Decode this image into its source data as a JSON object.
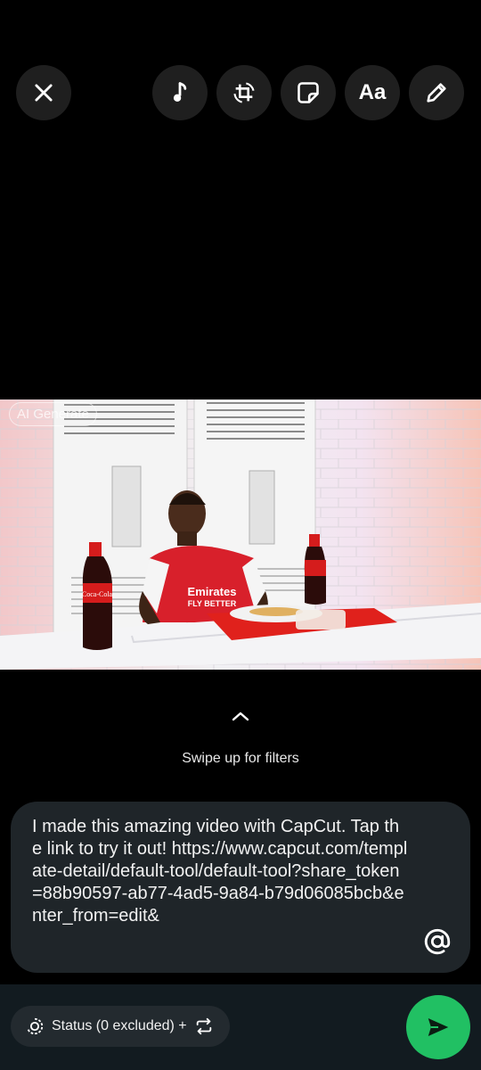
{
  "toolbar": {
    "close": "close-icon",
    "music": "music-note-icon",
    "crop": "crop-rotate-icon",
    "sticker": "sticker-icon",
    "text_label": "Aa",
    "draw": "pencil-icon"
  },
  "media": {
    "ai_badge": "AI Generate",
    "jersey_text": "Emirates FLY BETTER"
  },
  "filters": {
    "hint": "Swipe up for filters"
  },
  "caption": {
    "text": "I made this amazing video with CapCut. Tap the link to try it out! https://www.capcut.com/template-detail/default-tool/default-tool?share_token=88b90597-ab77-4ad5-9a84-b79d06085bcb&enter_from=edit&",
    "mention_icon": "at-sign-icon"
  },
  "footer": {
    "status_label": "Status (0 excluded) +",
    "send_icon": "send-icon"
  },
  "colors": {
    "accent": "#21c063",
    "panel": "#1f2529",
    "bar": "#121b20"
  }
}
